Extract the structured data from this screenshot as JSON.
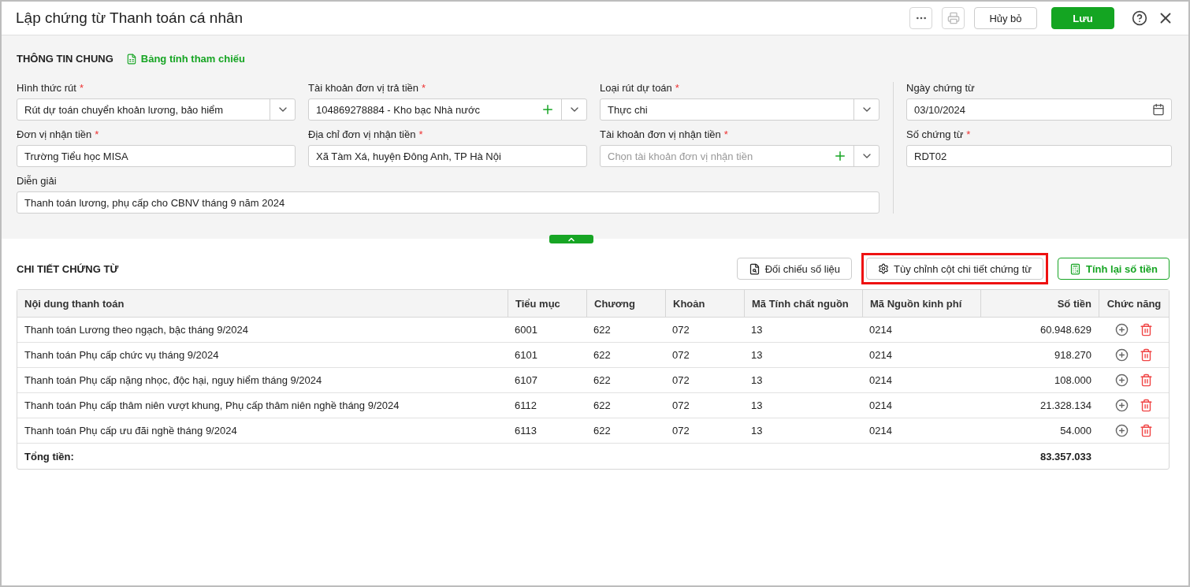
{
  "window": {
    "title": "Lập chứng từ Thanh toán cá nhân",
    "buttons": [
      {
        "kind": "more"
      },
      {
        "kind": "print",
        "disabled": true
      },
      {
        "kind": "cancel",
        "label": "Hủy bỏ"
      },
      {
        "kind": "save",
        "label": "Lưu"
      },
      {
        "kind": "help"
      },
      {
        "kind": "close"
      }
    ]
  },
  "general": {
    "title": "THÔNG TIN CHUNG",
    "link": "Bảng tính tham chiếu",
    "required_mark": "*",
    "fields": [
      {
        "label": "Hình thức rút",
        "required": true,
        "kind": "select",
        "value": "Rút dự toán chuyển khoản lương, bảo hiểm"
      },
      {
        "label": "Tài khoản đơn vị trả tiền",
        "required": true,
        "kind": "select-add",
        "value": "104869278884 - Kho bạc Nhà nước"
      },
      {
        "label": "Loại rút dự toán",
        "required": true,
        "kind": "select",
        "value": "Thực chi"
      },
      {
        "label": "Đơn vị nhận tiền",
        "required": true,
        "kind": "text",
        "value": "Trường Tiểu học MISA"
      },
      {
        "label": "Địa chỉ đơn vị nhận tiền",
        "required": true,
        "kind": "text",
        "value": "Xã Tàm Xá, huyện Đông Anh, TP Hà Nội"
      },
      {
        "label": "Tài khoản đơn vị nhận tiền",
        "required": true,
        "kind": "select-add",
        "placeholder": "Chọn tài khoản đơn vị nhận tiền"
      },
      {
        "label": "Diễn giải",
        "required": false,
        "kind": "text",
        "wide": true,
        "value": "Thanh toán lương, phụ cấp cho CBNV tháng 9 năm 2024"
      }
    ],
    "side_fields": [
      {
        "label": "Ngày chứng từ",
        "required": false,
        "kind": "date",
        "value": "03/10/2024"
      },
      {
        "label": "Số chứng từ",
        "required": true,
        "kind": "text",
        "value": "RDT02"
      }
    ]
  },
  "detail": {
    "title": "CHI TIẾT CHỨNG TỪ",
    "actions": [
      {
        "kind": "compare",
        "label": "Đối chiếu số liệu",
        "highlighted": false
      },
      {
        "kind": "columns",
        "label": "Tùy chỉnh cột chi tiết chứng từ",
        "highlighted": true
      },
      {
        "kind": "recalc",
        "label": "Tính lại số tiền",
        "highlighted": false
      }
    ],
    "table": {
      "columns": [
        "Nội dung thanh toán",
        "Tiểu mục",
        "Chương",
        "Khoản",
        "Mã Tính chất nguồn",
        "Mã Nguồn kinh phí",
        "Số tiền",
        "Chức năng"
      ],
      "rows": [
        [
          "Thanh toán Lương theo ngạch, bậc tháng 9/2024",
          "6001",
          "622",
          "072",
          "13",
          "0214",
          "60.948.629"
        ],
        [
          "Thanh toán Phụ cấp chức vụ tháng 9/2024",
          "6101",
          "622",
          "072",
          "13",
          "0214",
          "918.270"
        ],
        [
          "Thanh toán Phụ cấp nặng nhọc, độc hại, nguy hiểm tháng 9/2024",
          "6107",
          "622",
          "072",
          "13",
          "0214",
          "108.000"
        ],
        [
          "Thanh toán Phụ cấp thâm niên vượt khung, Phụ cấp thâm niên nghề tháng 9/2024",
          "6112",
          "622",
          "072",
          "13",
          "0214",
          "21.328.134"
        ],
        [
          "Thanh toán Phụ cấp ưu đãi nghề tháng 9/2024",
          "6113",
          "622",
          "072",
          "13",
          "0214",
          "54.000"
        ]
      ],
      "total": {
        "label": "Tổng tiền:",
        "value": "83.357.033"
      }
    }
  }
}
